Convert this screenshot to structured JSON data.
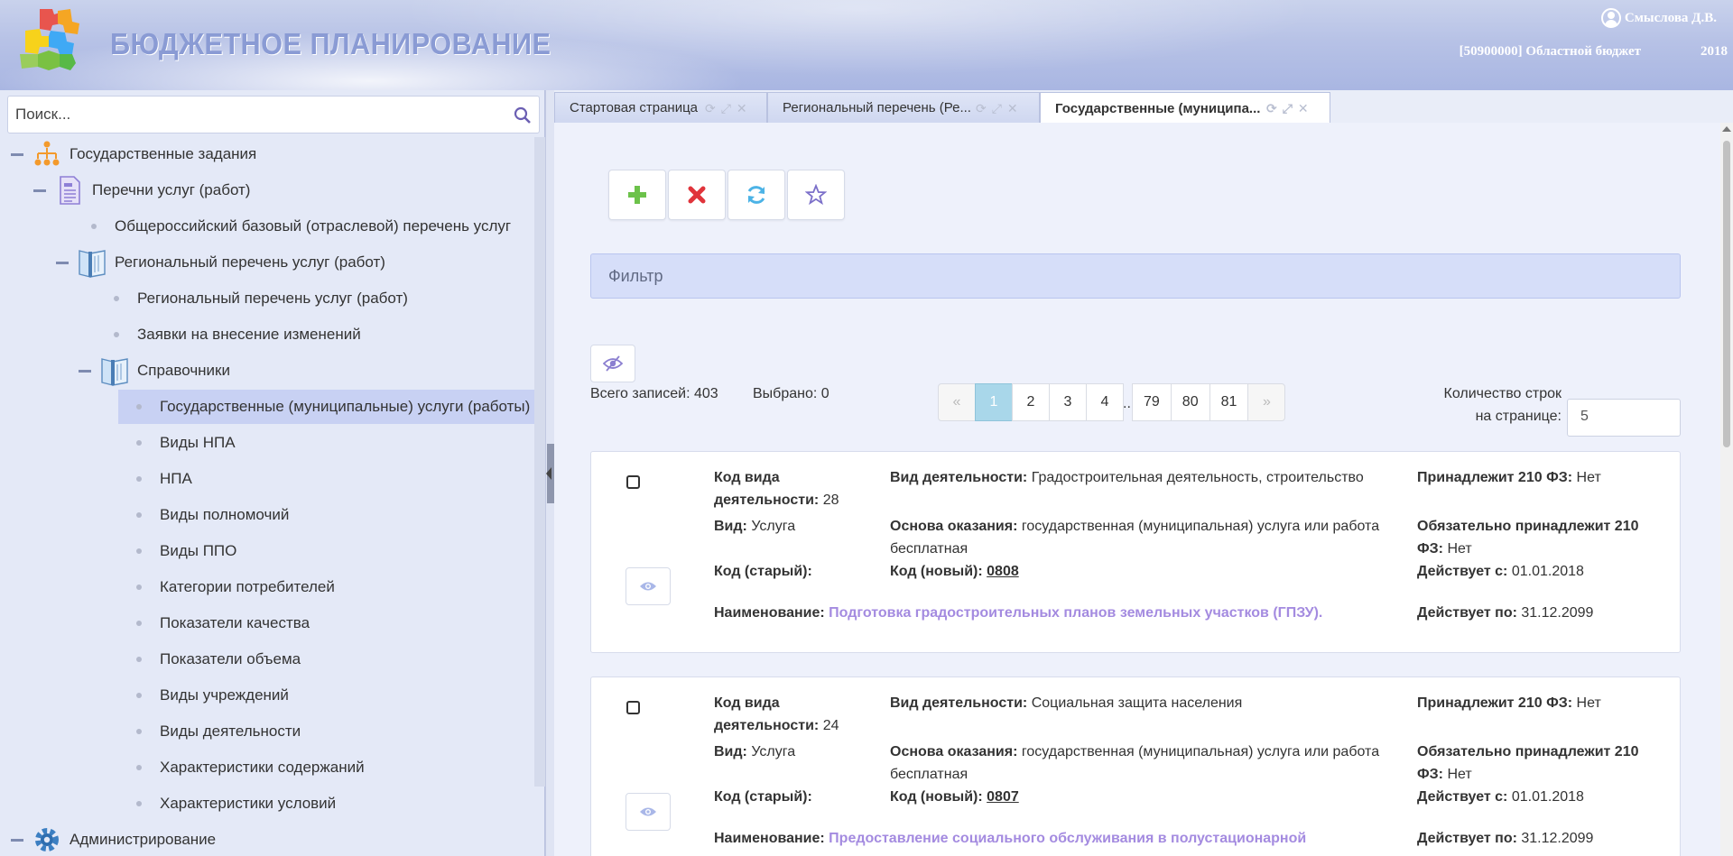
{
  "header": {
    "app_title": "БЮДЖЕТНОЕ ПЛАНИРОВАНИЕ",
    "user_name": "Смыслова Д.В.",
    "budget": "[50900000] Областной бюджет",
    "year": "2018"
  },
  "sidebar": {
    "search_placeholder": "Поиск...",
    "items": [
      {
        "label": "Государственные задания",
        "level": 0,
        "type": "folder",
        "icon": "org-chart-icon"
      },
      {
        "label": "Перечни услуг (работ)",
        "level": 1,
        "type": "folder",
        "icon": "document-icon"
      },
      {
        "label": "Общероссийский базовый (отраслевой) перечень услуг",
        "level": 2,
        "type": "leaf"
      },
      {
        "label": "Региональный перечень услуг (работ)",
        "level": 2,
        "type": "folder",
        "icon": "book-icon"
      },
      {
        "label": "Региональный перечень услуг (работ)",
        "level": 3,
        "type": "leaf"
      },
      {
        "label": "Заявки на внесение изменений",
        "level": 3,
        "type": "leaf"
      },
      {
        "label": "Справочники",
        "level": 3,
        "type": "folder",
        "icon": "book-icon"
      },
      {
        "label": "Государственные (муниципальные) услуги (работы)",
        "level": 4,
        "type": "leaf",
        "selected": true
      },
      {
        "label": "Виды НПА",
        "level": 4,
        "type": "leaf"
      },
      {
        "label": "НПА",
        "level": 4,
        "type": "leaf"
      },
      {
        "label": "Виды полномочий",
        "level": 4,
        "type": "leaf"
      },
      {
        "label": "Виды ППО",
        "level": 4,
        "type": "leaf"
      },
      {
        "label": "Категории потребителей",
        "level": 4,
        "type": "leaf"
      },
      {
        "label": "Показатели качества",
        "level": 4,
        "type": "leaf"
      },
      {
        "label": "Показатели объема",
        "level": 4,
        "type": "leaf"
      },
      {
        "label": "Виды учреждений",
        "level": 4,
        "type": "leaf"
      },
      {
        "label": "Виды деятельности",
        "level": 4,
        "type": "leaf"
      },
      {
        "label": "Характеристики содержаний",
        "level": 4,
        "type": "leaf"
      },
      {
        "label": "Характеристики условий",
        "level": 4,
        "type": "leaf"
      },
      {
        "label": "Администрирование",
        "level": 0,
        "type": "folder",
        "icon": "gear-icon"
      }
    ]
  },
  "tabs": [
    {
      "label": "Стартовая страница",
      "active": false
    },
    {
      "label": "Региональный перечень (Ре...",
      "active": false
    },
    {
      "label": "Государственные (муниципа...",
      "active": true
    }
  ],
  "toolbar": {
    "add_icon": "plus-icon",
    "delete_icon": "cross-icon",
    "refresh_icon": "refresh-icon",
    "favorite_icon": "star-icon"
  },
  "filter": {
    "label": "Фильтр"
  },
  "stats": {
    "total_label": "Всего записей: 403",
    "selected_label": "Выбрано: 0"
  },
  "pagination": {
    "prev": "«",
    "next": "»",
    "pages": [
      "1",
      "2",
      "3",
      "4",
      "79",
      "80",
      "81"
    ],
    "ellipsis": "...",
    "active_page": "1"
  },
  "rows_per_page": {
    "label": "Количество строк на странице:",
    "value": "5"
  },
  "labels": {
    "activity_code": "Код вида деятельности:",
    "activity_type": "Вид деятельности:",
    "belongs_210": "Принадлежит 210 ФЗ:",
    "kind": "Вид:",
    "basis": "Основа оказания:",
    "must_belong_210": "Обязательно принадлежит 210 ФЗ:",
    "code_old": "Код (старый):",
    "code_new": "Код (новый):",
    "valid_from": "Действует с:",
    "name": "Наименование:",
    "valid_to": "Действует по:"
  },
  "records": [
    {
      "activity_code": "28",
      "activity_type": "Градостроительная деятельность, строительство",
      "belongs_210": "Нет",
      "kind": "Услуга",
      "basis": "государственная (муниципальная) услуга или работа бесплатная",
      "must_belong_210": "Нет",
      "code_old": "",
      "code_new": "0808",
      "valid_from": "01.01.2018",
      "name": "Подготовка градостроительных планов земельных участков (ГПЗУ).",
      "valid_to": "31.12.2099"
    },
    {
      "activity_code": "24",
      "activity_type": "Социальная защита населения",
      "belongs_210": "Нет",
      "kind": "Услуга",
      "basis": "государственная (муниципальная) услуга или работа бесплатная",
      "must_belong_210": "Нет",
      "code_old": "",
      "code_new": "0807",
      "valid_from": "01.01.2018",
      "name": "Предоставление социального обслуживания в полустационарной",
      "valid_to": "31.12.2099"
    }
  ]
}
